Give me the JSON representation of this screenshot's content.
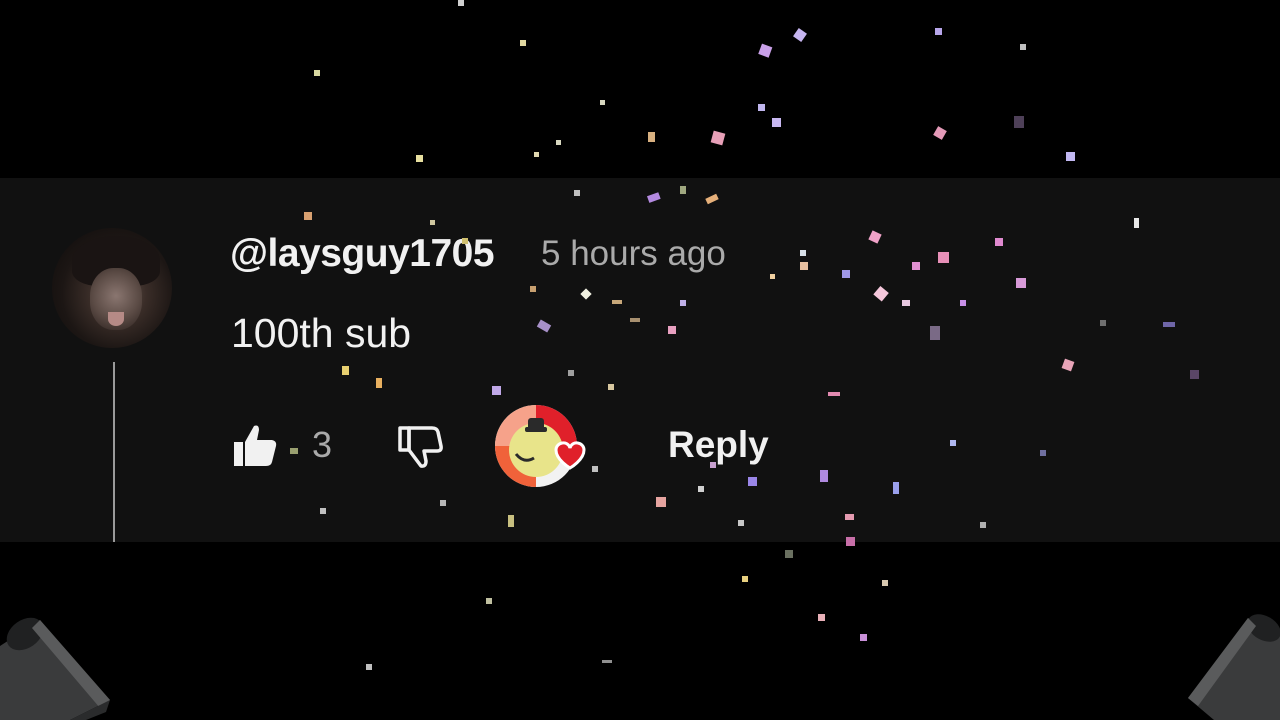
{
  "comment": {
    "username": "@laysguy1705",
    "timestamp": "5 hours ago",
    "text": "100th sub",
    "like_count": "3",
    "reply_label": "Reply"
  },
  "icons": {
    "like": "thumbs-up-icon",
    "dislike": "thumbs-down-icon",
    "creator_heart": "creator-heart-icon",
    "popper": "party-popper-icon"
  },
  "colors": {
    "background": "#000000",
    "panel": "#111111",
    "text_primary": "#f1f1f1",
    "text_secondary": "#aaaaaa",
    "heart": "#e0202a"
  }
}
